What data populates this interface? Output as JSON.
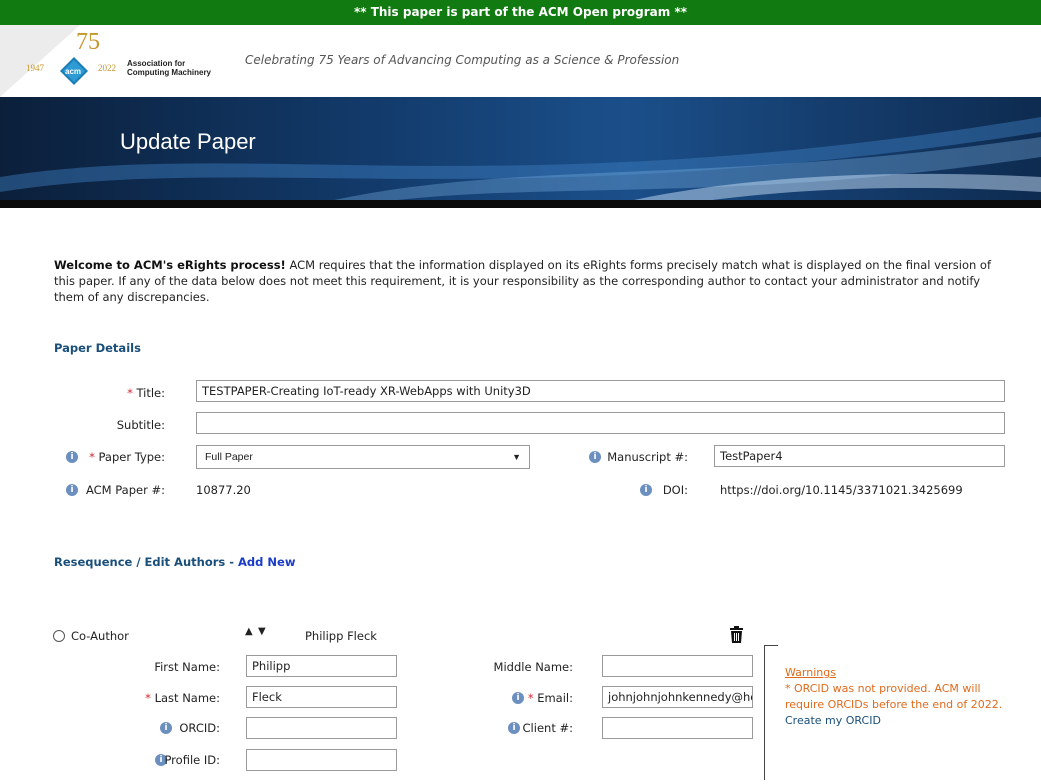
{
  "banner": {
    "text": "** This paper is part of the ACM Open program **"
  },
  "logo": {
    "year_start": "1947",
    "year_end": "2022",
    "anniversary": "75",
    "badge": "acm",
    "org_line1": "Association for",
    "org_line2": "Computing Machinery"
  },
  "tagline": "Celebrating 75 Years of Advancing Computing as a Science & Profession",
  "hero": {
    "title": "Update Paper"
  },
  "welcome": {
    "lead": "Welcome to ACM's eRights process!",
    "body": " ACM requires that the information displayed on its eRights forms precisely match what is displayed on the final version of this paper. If any of the data below does not meet this requirement, it is your responsibility as the corresponding author to contact your administrator and notify them of any discrepancies."
  },
  "paper_details": {
    "heading": "Paper Details",
    "required_mark": "*",
    "title_label": "Title:",
    "title_value": "TESTPAPER-Creating IoT-ready XR-WebApps with Unity3D",
    "subtitle_label": "Subtitle:",
    "subtitle_value": "",
    "paper_type_label": "Paper Type:",
    "paper_type_value": "Full Paper",
    "manuscript_label": "Manuscript #:",
    "manuscript_value": "TestPaper4",
    "acm_paper_label": "ACM Paper #:",
    "acm_paper_value": "10877.20",
    "doi_label": "DOI:",
    "doi_value": "https://doi.org/10.1145/3371021.3425699"
  },
  "authors": {
    "heading": "Resequence / Edit Authors",
    "separator": " - ",
    "add_new": "Add New",
    "role": "Co-Author",
    "display_name": "Philipp Fleck",
    "first_name_label": "First Name:",
    "first_name_value": "Philipp",
    "middle_name_label": "Middle Name:",
    "middle_name_value": "",
    "last_name_label": "Last Name:",
    "last_name_value": "Fleck",
    "email_label": "Email:",
    "email_value": "johnjohnjohnkennedy@ho",
    "orcid_label": "ORCID:",
    "orcid_value": "",
    "client_label": "Client #:",
    "client_value": "",
    "profile_label": "Profile ID:",
    "profile_value": ""
  },
  "warnings": {
    "title": "Warnings",
    "text": "* ORCID was not provided. ACM will require ORCIDs before the end of 2022. ",
    "link": "Create my ORCID"
  },
  "colors": {
    "banner": "#117a11",
    "section_heading": "#1a4f7a",
    "required": "#d9262c",
    "warning": "#e06a1c",
    "link": "#1a3cc9"
  },
  "icons": [
    "info-icon",
    "trash-icon",
    "sort-up-icon",
    "sort-down-icon",
    "radio-icon"
  ]
}
